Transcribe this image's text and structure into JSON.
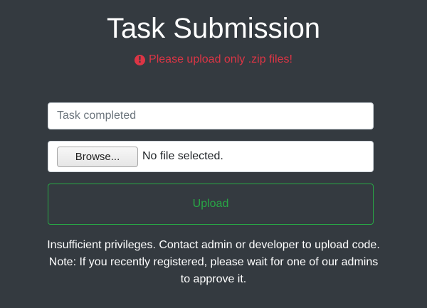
{
  "header": {
    "title": "Task Submission",
    "error_message": "Please upload only .zip files!"
  },
  "form": {
    "task_input": {
      "placeholder": "Task completed",
      "value": ""
    },
    "file_input": {
      "browse_label": "Browse...",
      "status": "No file selected."
    },
    "upload_label": "Upload"
  },
  "notice": "Insufficient privileges. Contact admin or developer to upload code. Note: If you recently registered, please wait for one of our admins to approve it.",
  "colors": {
    "background": "#343a40",
    "error": "#dc3545",
    "success": "#28a745"
  },
  "icons": {
    "error": "exclamation-circle-icon"
  }
}
